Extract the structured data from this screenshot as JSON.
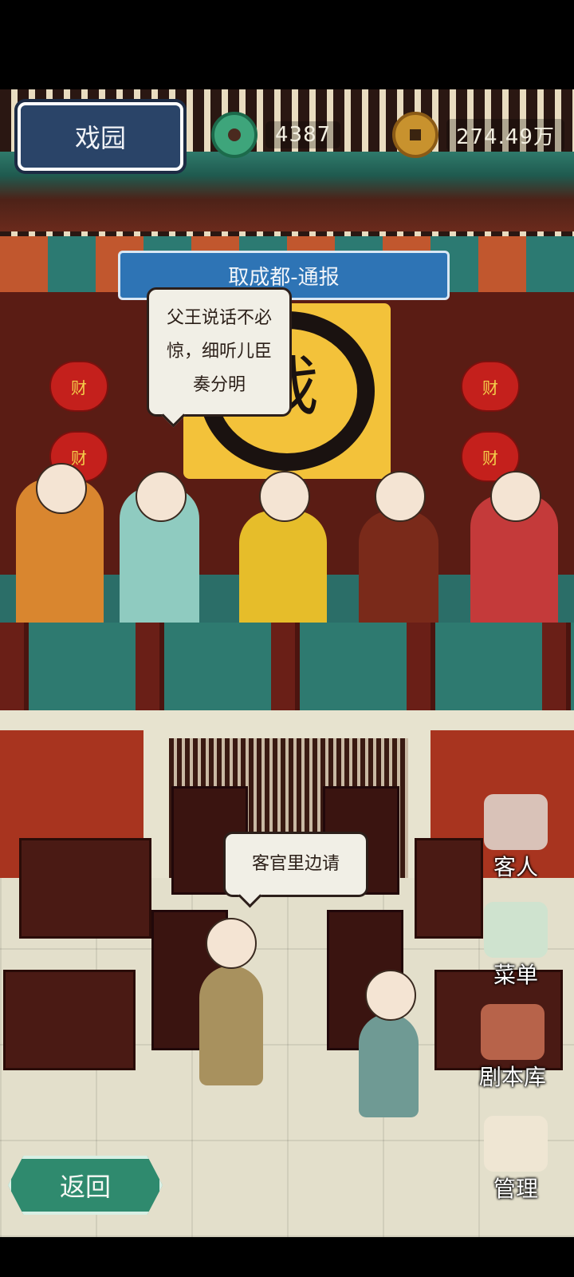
{
  "header": {
    "place_label": "戏园",
    "jade_count": "4387",
    "coin_count": "274.49万"
  },
  "stage": {
    "play_title": "取成都-通报",
    "emblem_char": "戏",
    "lantern_char": "财",
    "dialogue": "父王说话不必惊，细听儿臣奏分明"
  },
  "hall": {
    "waiter_dialogue": "客官里边请"
  },
  "side_menu": [
    {
      "label": "客人",
      "icon": "guests-icon"
    },
    {
      "label": "菜单",
      "icon": "menu-icon"
    },
    {
      "label": "剧本库",
      "icon": "script-library-icon"
    },
    {
      "label": "管理",
      "icon": "manage-icon"
    }
  ],
  "back_label": "返回",
  "colors": {
    "jade": "#2f8a6e",
    "sign_blue": "#2a4468",
    "banner_blue": "#2e74b5",
    "coin_gold": "#c8922e"
  }
}
